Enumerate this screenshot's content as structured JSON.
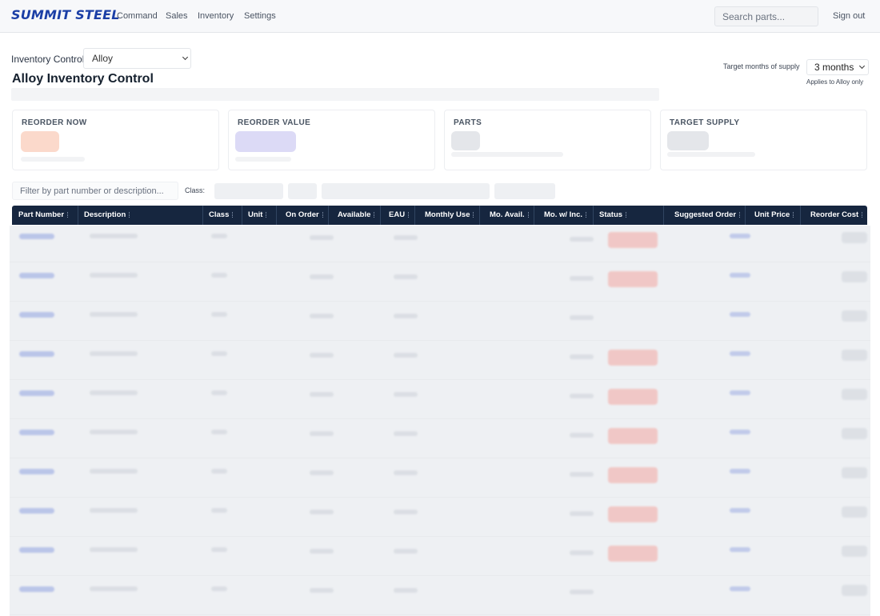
{
  "app": {
    "logo": "SUMMIT STEEL",
    "nav": [
      "Command",
      "Sales",
      "Inventory",
      "Settings"
    ],
    "search_placeholder": "Search parts...",
    "sign_out": "Sign out"
  },
  "context": {
    "label": "Inventory Control",
    "selected": "Alloy"
  },
  "page": {
    "title": "Alloy Inventory Control",
    "target_months_label": "Target months of supply",
    "target_months_value": "3 months",
    "applies_note": "Applies to Alloy only"
  },
  "cards": [
    {
      "label": "REORDER NOW",
      "accent": "#f26b3a"
    },
    {
      "label": "REORDER VALUE",
      "accent": "#6d63d6"
    },
    {
      "label": "PARTS",
      "accent": "#9aa3ad"
    },
    {
      "label": "TARGET SUPPLY",
      "accent": "#9aa3ad"
    }
  ],
  "filters": {
    "placeholder": "Filter by part number or description...",
    "class_label": "Class:"
  },
  "table": {
    "columns": [
      "Part Number",
      "Description",
      "Class",
      "Unit",
      "On Order",
      "Available",
      "EAU",
      "Monthly Use",
      "Mo. Avail.",
      "Mo. w/ Inc.",
      "Status",
      "Suggested Order",
      "Unit Price",
      "Reorder Cost"
    ],
    "row_count_visible": 10
  },
  "colors": {
    "header_bg": "#16263f",
    "status_alert": "#f3a7a2",
    "link_blue": "#5b76d6"
  }
}
